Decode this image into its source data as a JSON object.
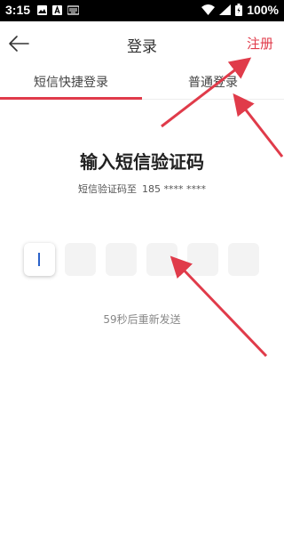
{
  "status_bar": {
    "time": "3:15",
    "battery": "100%",
    "icons": [
      "image-icon",
      "font-icon",
      "keyboard-icon",
      "wifi-icon",
      "signal-icon",
      "battery-icon"
    ]
  },
  "header": {
    "title": "登录",
    "register_label": "注册"
  },
  "tabs": [
    {
      "label": "短信快捷登录",
      "active": true
    },
    {
      "label": "普通登录",
      "active": false
    }
  ],
  "main": {
    "heading": "输入短信验证码",
    "sent_to_label": "短信验证码至",
    "phone": "185 **** ****",
    "code_digits": [
      "",
      "",
      "",
      "",
      "",
      ""
    ],
    "resend_text": "59秒后重新发送"
  },
  "colors": {
    "accent": "#e03b4a",
    "arrow": "#e03b4a",
    "caret": "#2a62c9"
  }
}
